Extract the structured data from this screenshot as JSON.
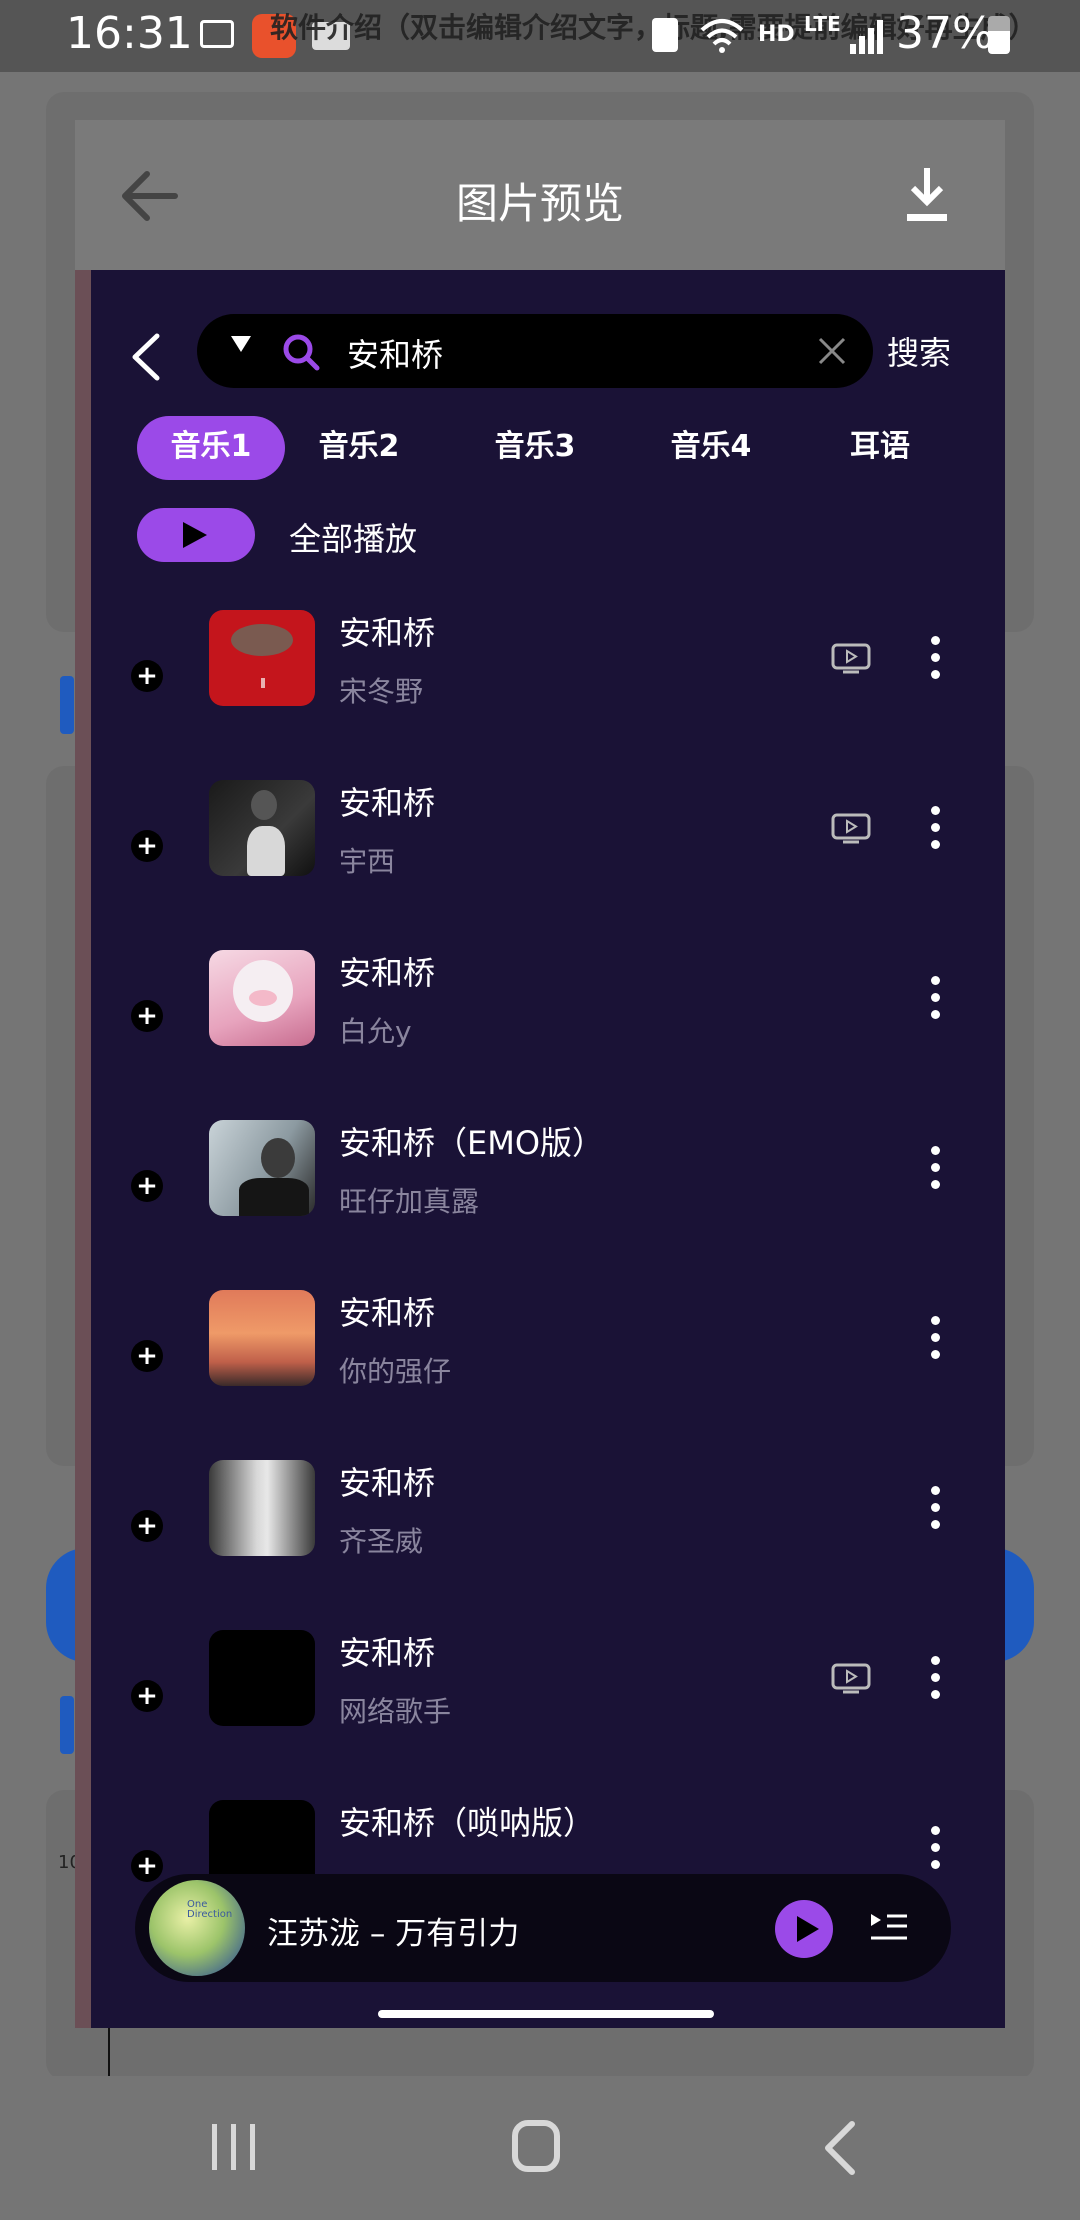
{
  "status_bar": {
    "time": "16:31",
    "overlay_text": "软件介绍（双击编辑介绍文字，标题,需要提前编辑好再生成）",
    "network_hd": "HD",
    "network_lte": "LTE",
    "battery_percent": "37%"
  },
  "background": {
    "small_text": "10"
  },
  "dialog": {
    "title": "图片预览"
  },
  "app": {
    "search": {
      "query": "安和桥",
      "button_label": "搜索"
    },
    "tabs": [
      {
        "label": "音乐1",
        "active": true
      },
      {
        "label": "音乐2",
        "active": false
      },
      {
        "label": "音乐3",
        "active": false
      },
      {
        "label": "音乐4",
        "active": false
      },
      {
        "label": "耳语",
        "active": false
      }
    ],
    "play_all_label": "全部播放",
    "songs": [
      {
        "title": "安和桥",
        "artist": "宋冬野",
        "has_mv": true,
        "cover": "red-album"
      },
      {
        "title": "安和桥",
        "artist": "宇西",
        "has_mv": true,
        "cover": "girl-cat-bw"
      },
      {
        "title": "安和桥",
        "artist": "白允y",
        "has_mv": false,
        "cover": "anime-girl-pink"
      },
      {
        "title": "安和桥（EMO版）",
        "artist": "旺仔加真露",
        "has_mv": false,
        "cover": "person-photo"
      },
      {
        "title": "安和桥",
        "artist": "你的强仔",
        "has_mv": false,
        "cover": "sunset-sky"
      },
      {
        "title": "安和桥",
        "artist": "齐圣威",
        "has_mv": false,
        "cover": "city-street-bw"
      },
      {
        "title": "安和桥",
        "artist": "网络歌手",
        "has_mv": true,
        "cover": "black"
      },
      {
        "title": "安和桥（唢呐版）",
        "artist": "",
        "has_mv": false,
        "cover": "black"
      }
    ],
    "mini_player": {
      "track": "汪苏泷 – 万有引力",
      "cover_text": "One Direction"
    }
  },
  "colors": {
    "accent": "#9b4ae8",
    "app_background": "#1a1236",
    "header_gray": "#7a7a7a"
  }
}
